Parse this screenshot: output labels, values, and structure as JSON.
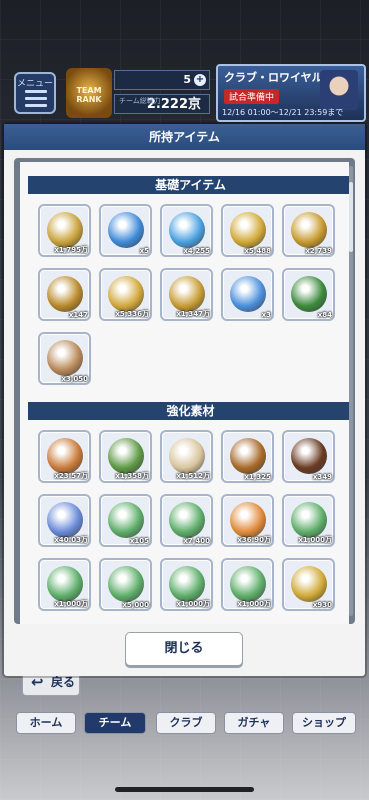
{
  "topbar": {
    "menu_label": "メニュー",
    "team_rank_label": "TEAM RANK",
    "stat1": "5",
    "stat2_caption": "チーム総戦力",
    "stat2": "2.222京",
    "club_royale_title": "クラブ・ロワイヤル",
    "club_royale_state": "試合準備中",
    "club_royale_time": "12/16 01:00〜12/21 23:59まで"
  },
  "modal": {
    "title": "所持アイテム",
    "close_label": "閉じる",
    "sections": [
      {
        "title": "基礎アイテム",
        "items": [
          {
            "icon": "gold-coin-ring-icon",
            "qty": "x1,795万",
            "color": "#c9a23a"
          },
          {
            "icon": "blue-crystal-cluster-icon",
            "qty": "x5",
            "color": "#3f8ad8"
          },
          {
            "icon": "blue-pentagon-gem-icon",
            "qty": "x4,255",
            "color": "#4aa0e0"
          },
          {
            "icon": "gold-pentagon-gem-icon",
            "qty": "x5,488",
            "color": "#d1a937"
          },
          {
            "icon": "gold-blue-pentagon-icon",
            "qty": "x2,739",
            "color": "#c79a2e"
          },
          {
            "icon": "gold-ticket-icon",
            "qty": "x147",
            "color": "#b98a2a"
          },
          {
            "icon": "gold-ball-coin-icon",
            "qty": "x5,336万",
            "color": "#d3a83c"
          },
          {
            "icon": "gold-trophy-coin-icon",
            "qty": "x1,347万",
            "color": "#c79c34"
          },
          {
            "icon": "stopwatch-icon",
            "qty": "x3",
            "color": "#4b8fdb"
          },
          {
            "icon": "green-meter-icon",
            "qty": "x84",
            "color": "#3c8a3c"
          },
          {
            "icon": "cr-coin-icon",
            "qty": "x3,050",
            "color": "#b98a5a"
          }
        ]
      },
      {
        "title": "強化素材",
        "items": [
          {
            "icon": "rice-bowl-icon",
            "qty": "x23.57万",
            "color": "#c97a3a"
          },
          {
            "icon": "salad-icon",
            "qty": "x1,358万",
            "color": "#5e9a45"
          },
          {
            "icon": "gyoza-plate-icon",
            "qty": "x1,512万",
            "color": "#d8c49c"
          },
          {
            "icon": "curry-icon",
            "qty": "x1,325",
            "color": "#a86a2a"
          },
          {
            "icon": "steak-plate-icon",
            "qty": "x349",
            "color": "#6a3a22"
          },
          {
            "icon": "rainbow-ball-icon",
            "qty": "x40.03万",
            "color": "#6a8ad8"
          },
          {
            "icon": "green-ball-icon",
            "qty": "x105",
            "color": "#5eae6a"
          },
          {
            "icon": "green-ball-icon",
            "qty": "x7,400",
            "color": "#5eae6a"
          },
          {
            "icon": "orange-ball-icon",
            "qty": "x36.90万",
            "color": "#e08a3a"
          },
          {
            "icon": "green-ball-icon",
            "qty": "x1,000万",
            "color": "#5eae6a"
          },
          {
            "icon": "green-ball-icon",
            "qty": "x1,000万",
            "color": "#5eae6a"
          },
          {
            "icon": "green-ball-icon",
            "qty": "x5,000",
            "color": "#5eae6a"
          },
          {
            "icon": "green-ball-icon",
            "qty": "x1,000万",
            "color": "#5eae6a"
          },
          {
            "icon": "green-ball-icon",
            "qty": "x1,000万",
            "color": "#5eae6a"
          },
          {
            "icon": "gold-ball-trophy-icon",
            "qty": "x930",
            "color": "#d1a937"
          }
        ]
      }
    ]
  },
  "bottom": {
    "back_label": "戻る",
    "nav": [
      {
        "label": "ホーム",
        "active": false
      },
      {
        "label": "チーム",
        "active": true
      },
      {
        "label": "クラブ",
        "active": false
      },
      {
        "label": "ガチャ",
        "active": false
      },
      {
        "label": "ショップ",
        "active": false
      }
    ]
  }
}
